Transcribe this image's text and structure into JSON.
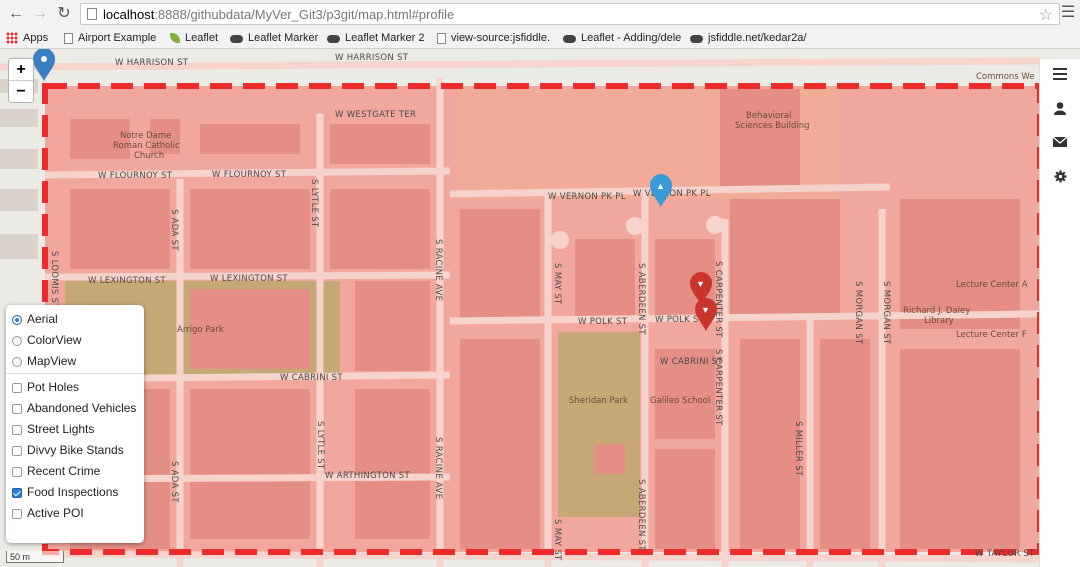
{
  "browser": {
    "url_host": "localhost",
    "url_path": ":8888/githubdata/MyVer_Git3/p3git/map.html#profile"
  },
  "bookmarks": [
    {
      "label": "Apps",
      "icon": "apps-grid-icon"
    },
    {
      "label": "Airport Example",
      "icon": "document-icon"
    },
    {
      "label": "Leaflet",
      "icon": "leaflet-icon"
    },
    {
      "label": "Leaflet Marker",
      "icon": "cloud-icon"
    },
    {
      "label": "Leaflet Marker 2",
      "icon": "cloud-icon"
    },
    {
      "label": "view-source:jsfiddle.",
      "icon": "document-icon"
    },
    {
      "label": "Leaflet - Adding/dele",
      "icon": "document-icon"
    },
    {
      "label": "jsfiddle.net/kedar2a/",
      "icon": "cloud-icon"
    }
  ],
  "map": {
    "zoom_in": "+",
    "zoom_out": "−",
    "scale": "50 m",
    "streets": {
      "w_harrison": "W HARRISON ST",
      "w_westgate": "W WESTGATE TER",
      "w_flournoy": "W FLOURNOY ST",
      "w_vernon": "W VERNON PK PL",
      "w_lexington": "W LEXINGTON ST",
      "w_polk": "W POLK ST",
      "w_cabrini": "W CABRINI ST",
      "w_arthington": "W ARTHINGTON ST",
      "w_taylor": "W TAYLOR ST",
      "s_loomis": "S LOOMIS ST",
      "s_ada": "S ADA ST",
      "s_lytle": "S LYTLE ST",
      "s_racine": "S RACINE AVE",
      "s_may": "S MAY ST",
      "s_aberdeen": "S ABERDEEN ST",
      "s_carpenter": "S CARPENTER ST",
      "s_miller": "S MILLER ST",
      "s_morgan": "S MORGAN ST"
    },
    "places": {
      "notre_dame": [
        "Notre Dame",
        "Roman Catholic",
        "Church"
      ],
      "behavioral": [
        "Behavioral",
        "Sciences Building"
      ],
      "arrigo": "Arrigo Park",
      "sheridan": "Sheridan Park",
      "galileo": "Galileo School",
      "daley": [
        "Richard J. Daley",
        "Library"
      ],
      "lecture_a": "Lecture Center A",
      "lecture_f": "Lecture Center F",
      "commons": "Commons We"
    }
  },
  "layer_control": {
    "base_layers": [
      {
        "label": "Aerial",
        "selected": true
      },
      {
        "label": "ColorView",
        "selected": false
      },
      {
        "label": "MapView",
        "selected": false
      }
    ],
    "overlays": [
      {
        "label": "Pot Holes",
        "checked": false
      },
      {
        "label": "Abandoned Vehicles",
        "checked": false
      },
      {
        "label": "Street Lights",
        "checked": false
      },
      {
        "label": "Divvy Bike Stands",
        "checked": false
      },
      {
        "label": "Recent Crime",
        "checked": false
      },
      {
        "label": "Food Inspections",
        "checked": true
      },
      {
        "label": "Active POI",
        "checked": false
      }
    ]
  },
  "sidebar_tabs": [
    {
      "icon": "menu-icon"
    },
    {
      "icon": "user-icon"
    },
    {
      "icon": "envelope-icon"
    },
    {
      "icon": "gear-icon"
    }
  ],
  "colors": {
    "overlay_fill": "#f2a39a",
    "dashed_border": "#ee2b2b",
    "marker_blue": "#3a9bd9",
    "marker_red": "#c9352b"
  }
}
